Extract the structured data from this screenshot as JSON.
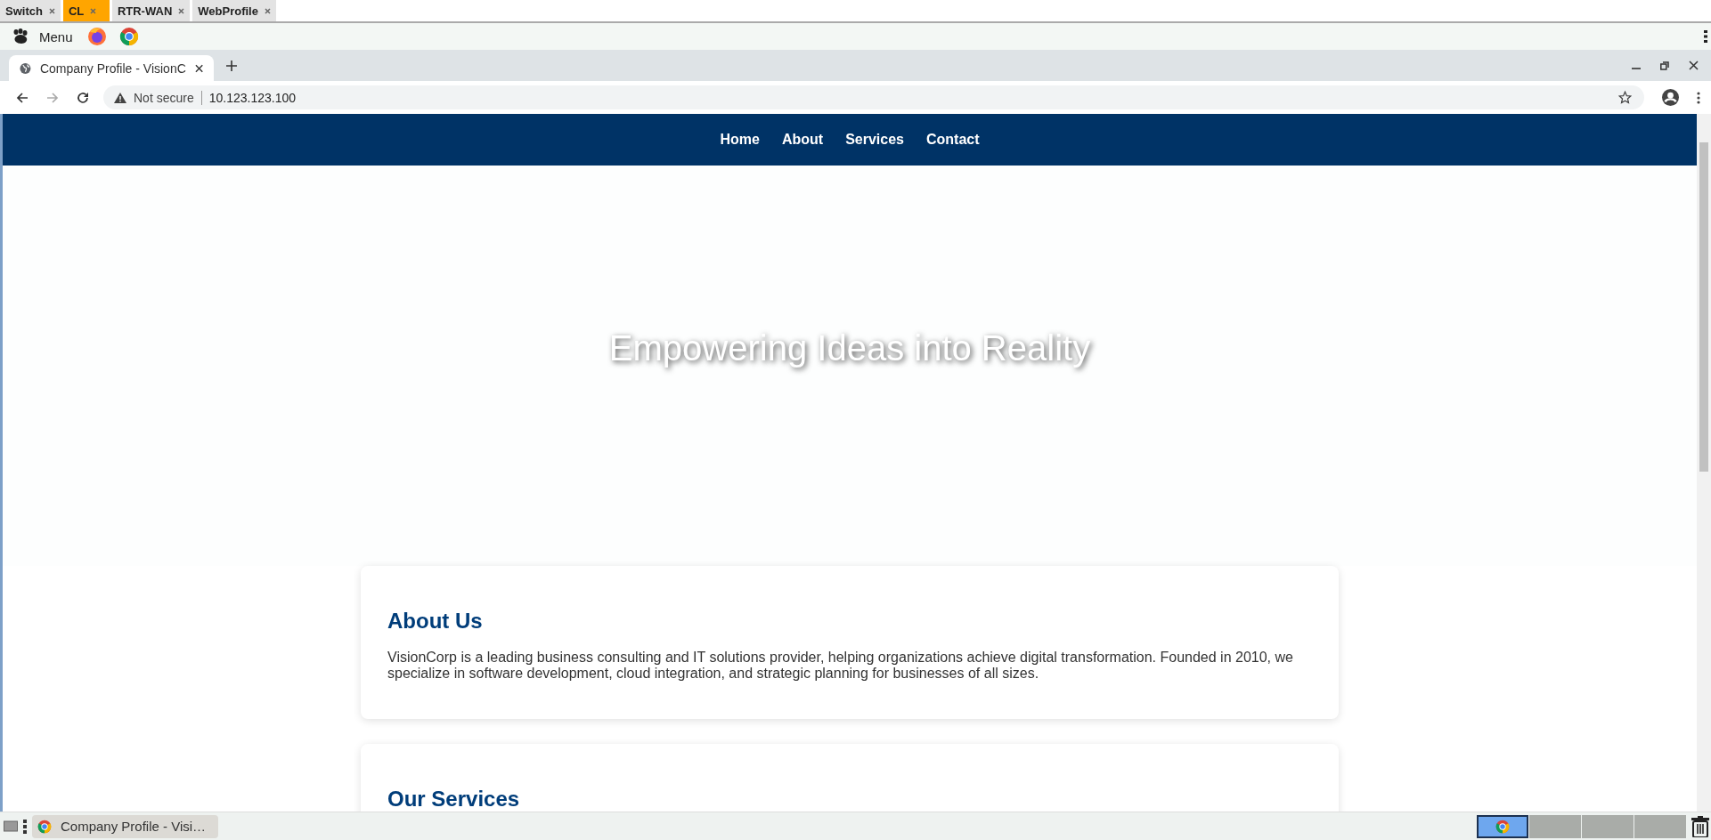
{
  "session_tabs": [
    {
      "label": "Switch",
      "selected": false
    },
    {
      "label": "CL",
      "selected": true
    },
    {
      "label": "RTR-WAN",
      "selected": false
    },
    {
      "label": "WebProfile",
      "selected": false
    }
  ],
  "menu_bar": {
    "label": "Menu"
  },
  "browser_tabs": [
    {
      "title": "Company Profile - VisionC",
      "selected": true
    }
  ],
  "address_bar": {
    "security": "Not secure",
    "url": "10.123.123.100"
  },
  "site_nav": [
    "Home",
    "About",
    "Services",
    "Contact"
  ],
  "hero": {
    "heading": "Empowering Ideas into Reality"
  },
  "sections": [
    {
      "heading": "About Us",
      "text": "VisionCorp is a leading business consulting and IT solutions provider, helping organizations achieve digital transformation. Founded in 2010, we specialize in software development, cloud integration, and strategic planning for businesses of all sizes."
    },
    {
      "heading": "Our Services"
    }
  ],
  "taskbar": {
    "windows": [
      {
        "title": "Company Profile - Visi…"
      }
    ],
    "workspaces": [
      {
        "selected": true
      },
      {
        "selected": false
      },
      {
        "selected": false
      },
      {
        "selected": false
      }
    ]
  }
}
